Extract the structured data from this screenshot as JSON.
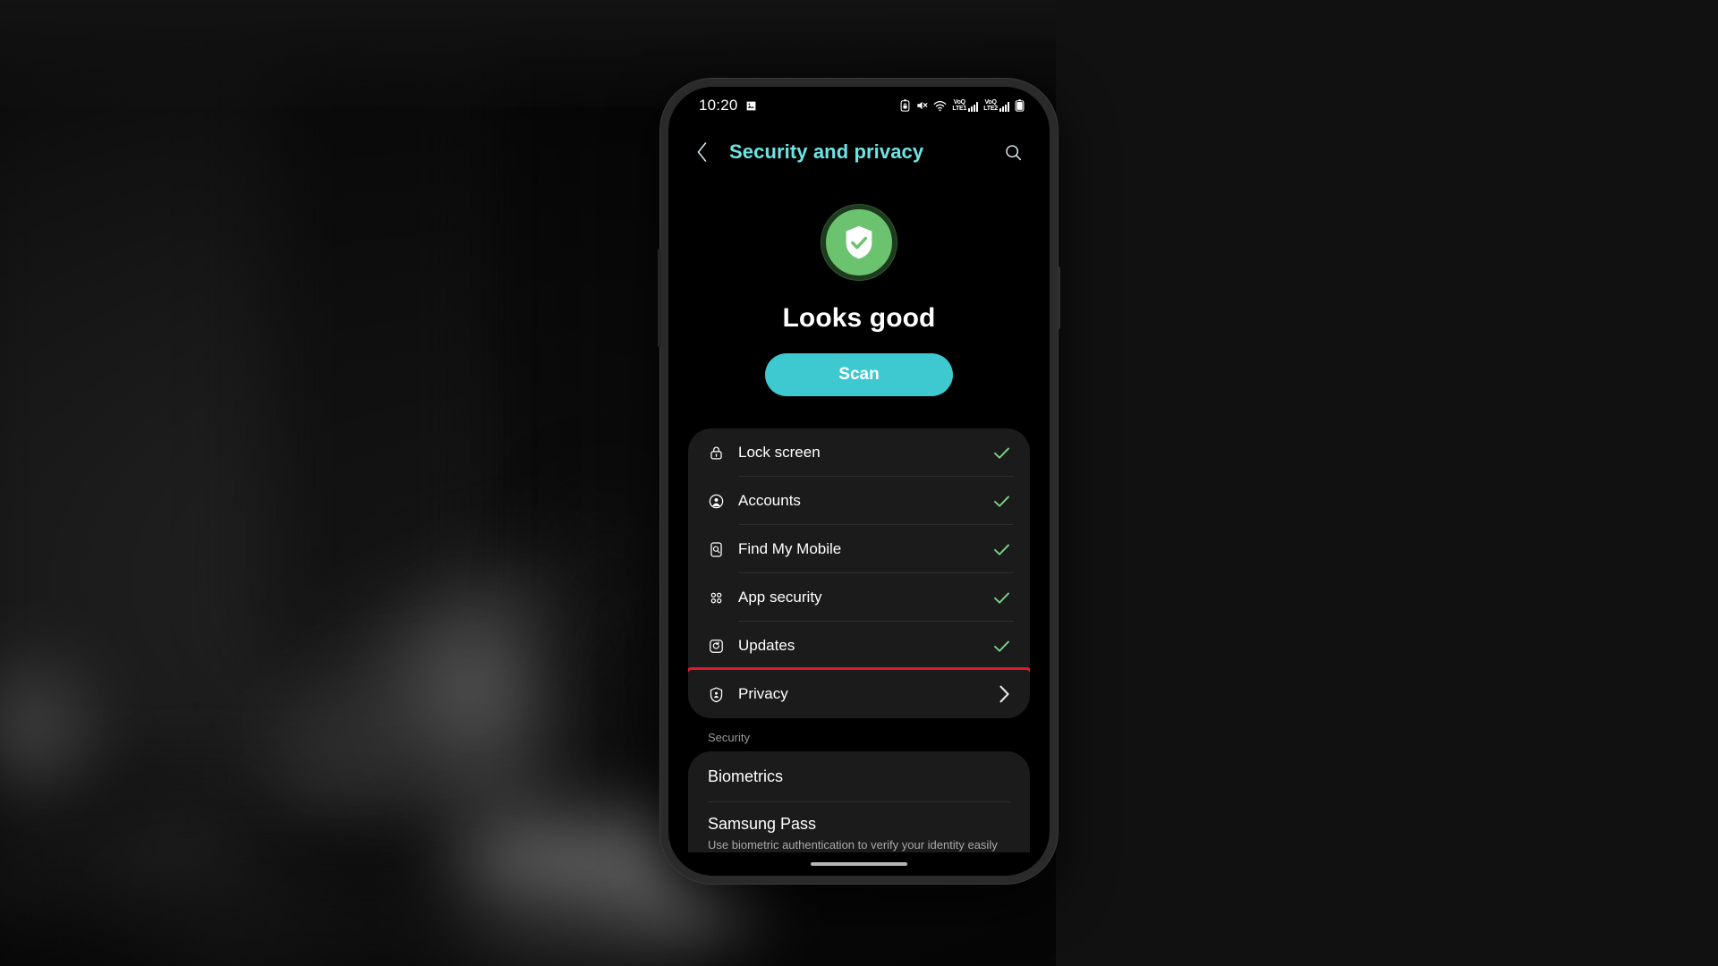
{
  "status_bar": {
    "clock": "10:20",
    "left_icons": [
      "image-icon"
    ],
    "right_icons": [
      "battery-lock-icon",
      "mute-icon",
      "wifi-icon",
      "signal-lte1-icon",
      "signal-lte2-icon",
      "battery-icon"
    ],
    "sim1_label": "VoQ",
    "sim1_network": "LTE1",
    "sim2_label": "VoQ",
    "sim2_network": "LTE2"
  },
  "header": {
    "back_icon": "chevron-left-icon",
    "title": "Security and privacy",
    "search_icon": "search-icon",
    "title_color": "#6fe3e3"
  },
  "hero": {
    "badge_icon": "shield-check-icon",
    "badge_color": "#6cc36f",
    "status_text": "Looks good",
    "scan_label": "Scan",
    "scan_color": "#3ec8cf"
  },
  "status_items": [
    {
      "icon": "lock-icon",
      "label": "Lock screen",
      "trailing": "check",
      "highlighted": false
    },
    {
      "icon": "account-icon",
      "label": "Accounts",
      "trailing": "check",
      "highlighted": false
    },
    {
      "icon": "find-my-mobile-icon",
      "label": "Find My Mobile",
      "trailing": "check",
      "highlighted": false
    },
    {
      "icon": "app-security-icon",
      "label": "App security",
      "trailing": "check",
      "highlighted": false
    },
    {
      "icon": "updates-icon",
      "label": "Updates",
      "trailing": "check",
      "highlighted": false
    },
    {
      "icon": "privacy-icon",
      "label": "Privacy",
      "trailing": "chevron",
      "highlighted": true
    }
  ],
  "security_section": {
    "label": "Security",
    "items": [
      {
        "title": "Biometrics",
        "desc": ""
      },
      {
        "title": "Samsung Pass",
        "desc": "Use biometric authentication to verify your identity easily and securely."
      }
    ]
  },
  "nav": {
    "home_indicator": "home-indicator"
  },
  "accents": {
    "check_green": "#7ed48a",
    "highlight_red": "#e01933",
    "card_bg": "#1b1b1b",
    "screen_bg": "#000000"
  }
}
